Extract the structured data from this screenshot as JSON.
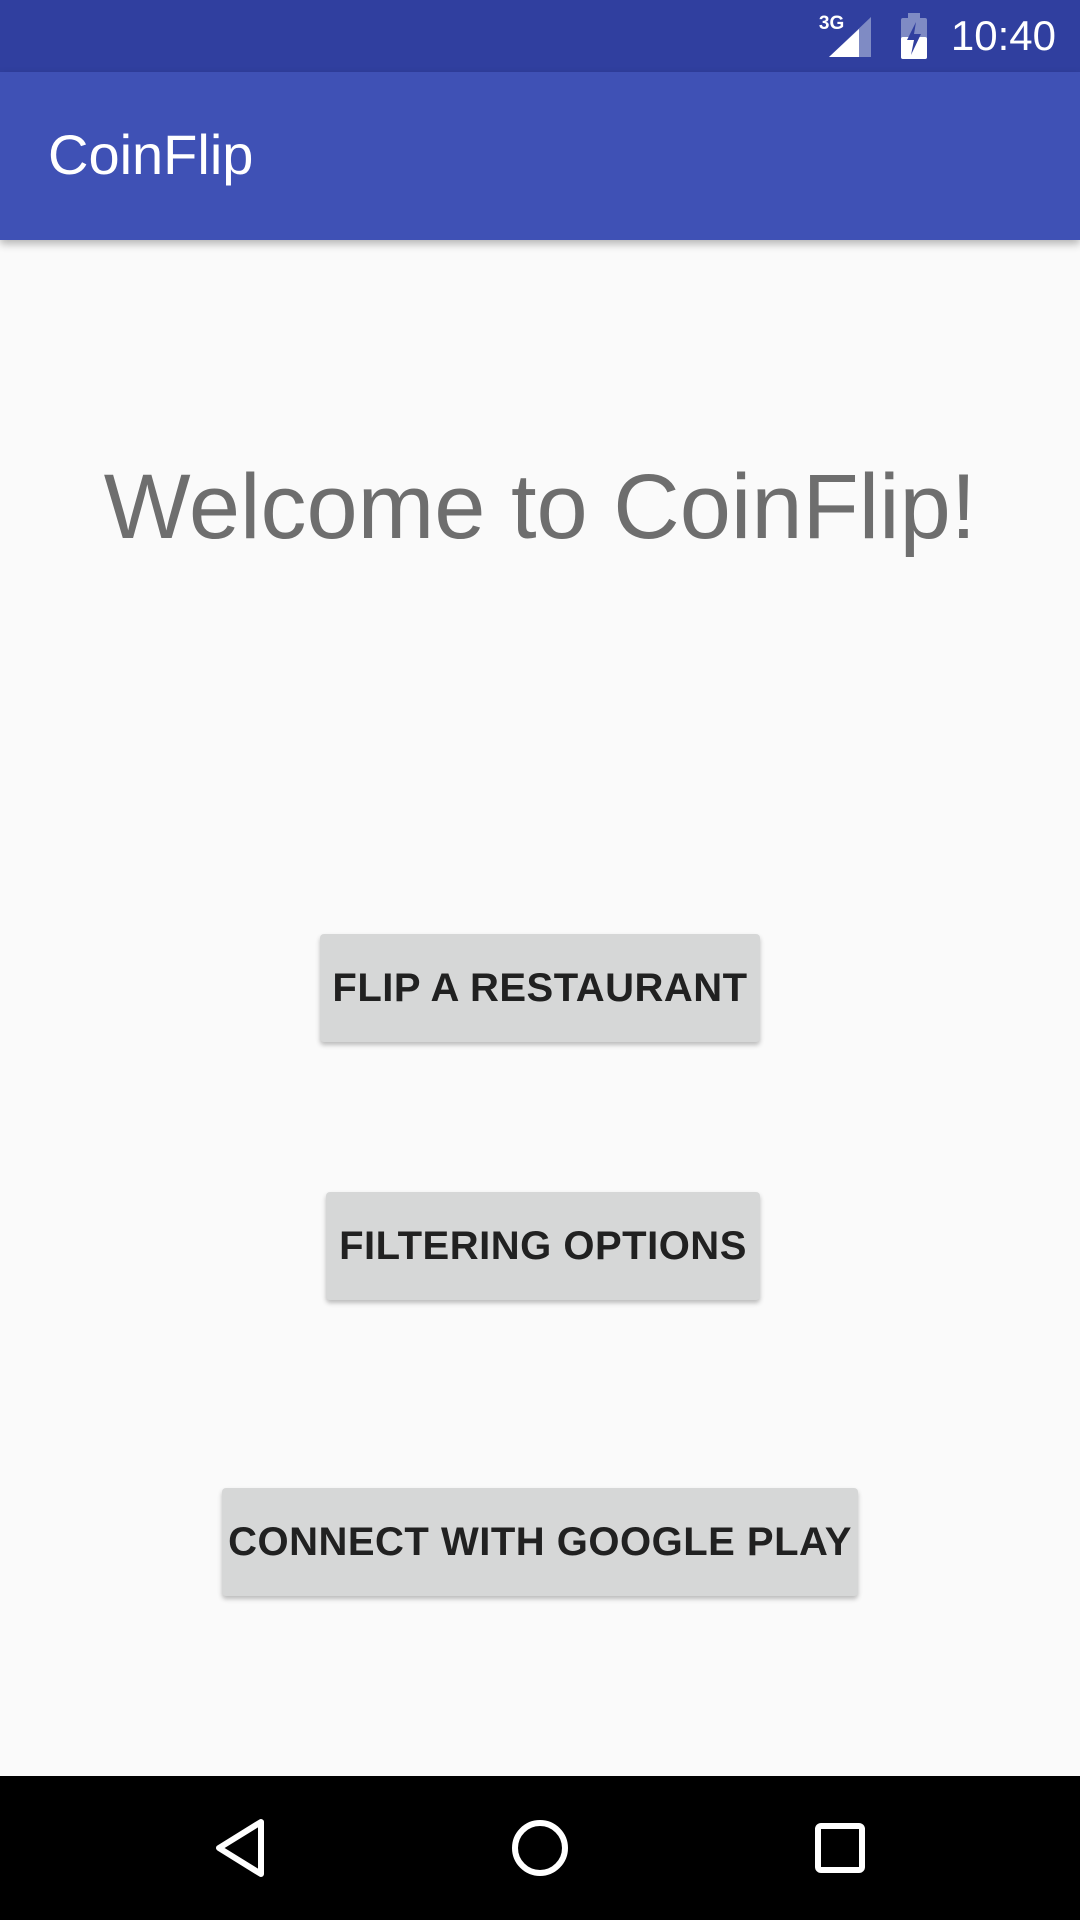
{
  "status_bar": {
    "network": "3G",
    "time": "10:40",
    "icons": [
      "signal-icon",
      "battery-charging-icon"
    ]
  },
  "app_bar": {
    "title": "CoinFlip"
  },
  "main": {
    "welcome_text": "Welcome to CoinFlip!",
    "buttons": {
      "flip": "FLIP A RESTAURANT",
      "filter": "FILTERING OPTIONS",
      "connect": "CONNECT WITH GOOGLE PLAY"
    }
  },
  "nav_bar": {
    "icons": [
      "back-icon",
      "home-icon",
      "recents-icon"
    ]
  },
  "colors": {
    "status_bar": "#303f9f",
    "primary": "#3f51b5",
    "background": "#fafafa",
    "button": "#d6d7d7",
    "welcome_text": "#6e6e6e"
  }
}
